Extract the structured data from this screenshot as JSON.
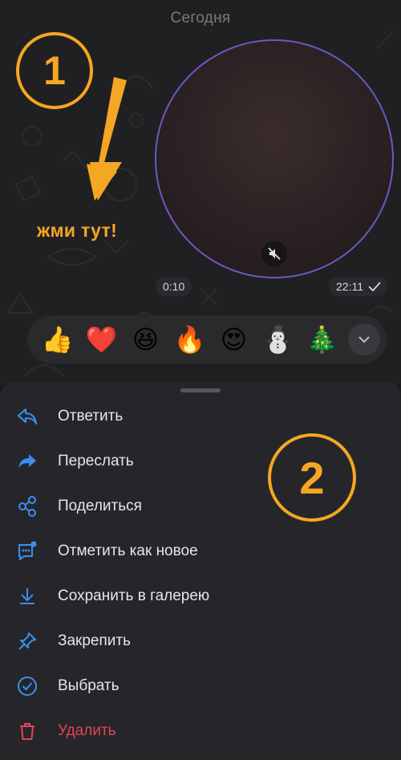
{
  "chat": {
    "date_label": "Сегодня"
  },
  "annotations": {
    "step1": "1",
    "step2": "2",
    "hint": "жми тут!",
    "accent_color": "#f5a623"
  },
  "video_message": {
    "duration": "0:10",
    "time": "22:11",
    "status_icon": "check-icon",
    "mute_icon": "muted-speaker-icon"
  },
  "reactions": {
    "items": [
      "👍",
      "❤️",
      "😆",
      "🔥",
      "😍",
      "⛄",
      "🎄"
    ],
    "expand_icon": "chevron-down-icon"
  },
  "context_menu": {
    "items": [
      {
        "label": "Ответить",
        "icon": "reply-icon"
      },
      {
        "label": "Переслать",
        "icon": "forward-icon"
      },
      {
        "label": "Поделиться",
        "icon": "share-icon"
      },
      {
        "label": "Отметить как новое",
        "icon": "mark-unread-icon"
      },
      {
        "label": "Сохранить в галерею",
        "icon": "download-icon"
      },
      {
        "label": "Закрепить",
        "icon": "pin-icon"
      },
      {
        "label": "Выбрать",
        "icon": "select-icon"
      },
      {
        "label": "Удалить",
        "icon": "trash-icon"
      }
    ],
    "icon_color": "#3a8ff0",
    "danger_color": "#e0455a"
  }
}
